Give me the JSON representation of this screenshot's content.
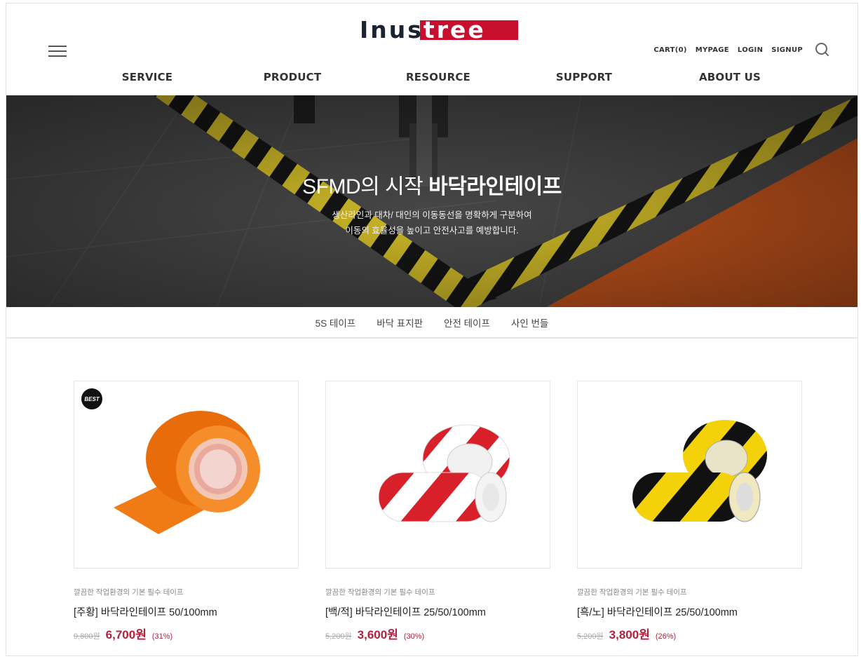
{
  "header": {
    "logo": {
      "text_dark": "Inus",
      "text_light": "tree"
    },
    "util_links": [
      "CART(0)",
      "MYPAGE",
      "LOGIN",
      "SIGNUP"
    ],
    "nav": [
      "SERVICE",
      "PRODUCT",
      "RESOURCE",
      "SUPPORT",
      "ABOUT US"
    ]
  },
  "hero": {
    "title_light": "SFMD의 시작 ",
    "title_bold": "바닥라인테이프",
    "sub_line1": "생산라인과 대차/ 대인의 이동동선을 명확하게 구분하여",
    "sub_line2": "이동의 효율성을 높이고 안전사고를 예방합니다."
  },
  "tabs": [
    "5S 테이프",
    "바닥 표지판",
    "안전 테이프",
    "사인 번들"
  ],
  "products": [
    {
      "badge": "BEST",
      "desc": "깔끔한 작업환경의 기본 필수 테이프",
      "name": "[주황] 바닥라인테이프 50/100mm",
      "orig_price": "9,800원",
      "sale_price": "6,700원",
      "discount": "(31%)",
      "colors": [
        "#f5780f",
        "#f5780f"
      ]
    },
    {
      "badge": "",
      "desc": "깔끔한 작업환경의 기본 필수 테이프",
      "name": "[백/적] 바닥라인테이프 25/50/100mm",
      "orig_price": "5,200원",
      "sale_price": "3,600원",
      "discount": "(30%)",
      "colors": [
        "#ffffff",
        "#d8202a"
      ]
    },
    {
      "badge": "",
      "desc": "깔끔한 작업환경의 기본 필수 테이프",
      "name": "[흑/노] 바닥라인테이프 25/50/100mm",
      "orig_price": "5,200원",
      "sale_price": "3,800원",
      "discount": "(26%)",
      "colors": [
        "#f4d20a",
        "#111111"
      ]
    }
  ]
}
